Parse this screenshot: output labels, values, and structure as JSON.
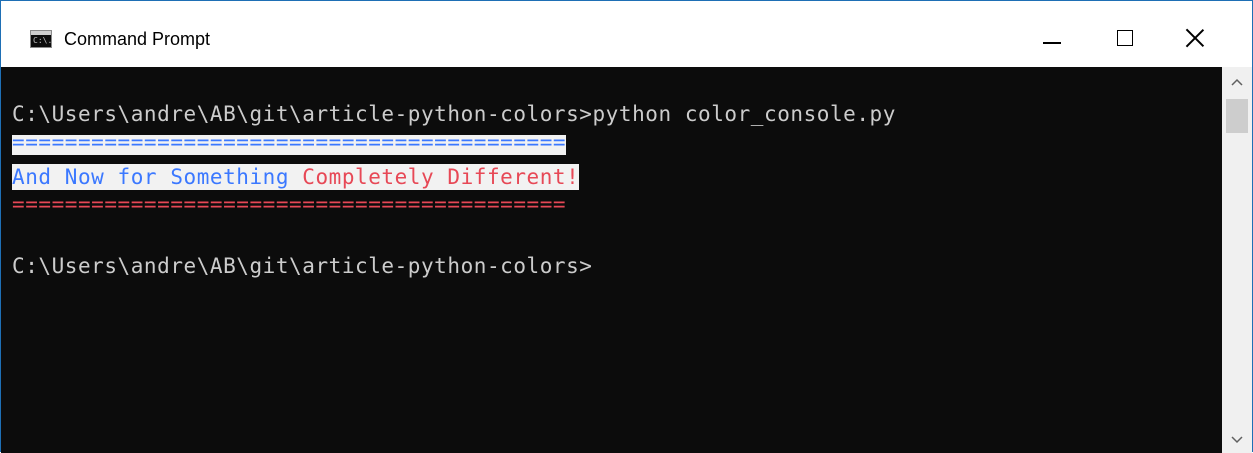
{
  "window": {
    "title": "Command Prompt",
    "icon_text": "C:\\."
  },
  "console": {
    "lines": [
      "C:\\Users\\andre\\AB\\git\\article-python-colors>python color_console.py",
      "==========================================",
      "And Now for Something",
      " Completely Different!",
      "==========================================",
      "C:\\Users\\andre\\AB\\git\\article-python-colors>"
    ]
  },
  "icons": {
    "app": "command-prompt-icon",
    "minimize": "minimize-icon",
    "maximize": "maximize-icon",
    "close": "close-icon",
    "scroll_up": "chevron-up-icon",
    "scroll_down": "chevron-down-icon"
  },
  "colors": {
    "console_bg": "#0c0c0c",
    "console_text": "#cccccc",
    "highlight_bg": "#f2f2f2",
    "blue_text": "#3b78ff",
    "red_text": "#e74856",
    "window_border": "#1e6fb5"
  }
}
